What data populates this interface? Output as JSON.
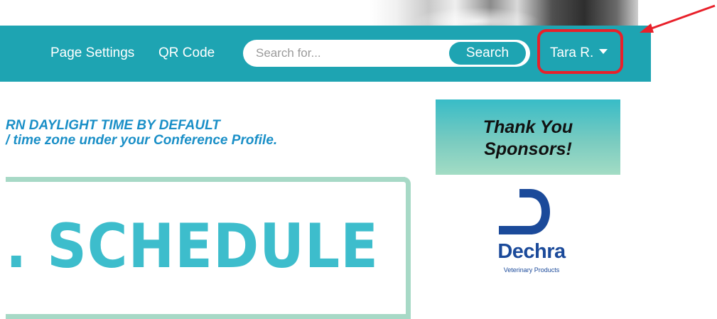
{
  "nav": {
    "page_settings": "Page Settings",
    "qr_code": "QR Code",
    "search": {
      "placeholder": "Search for...",
      "value": "",
      "button_label": "Search"
    },
    "user_name": "Tara R.",
    "user_menu_icon": "caret-down-icon"
  },
  "notice": {
    "line1": "RN DAYLIGHT TIME BY DEFAULT",
    "line2": "/ time zone under your Conference Profile."
  },
  "schedule": {
    "title": ". SCHEDULE"
  },
  "sponsors": {
    "banner_line1": "Thank You",
    "banner_line2": "Sponsors!",
    "logo_name": "Dechra",
    "logo_tagline": "Veterinary Products"
  },
  "annotation": {
    "highlight_color": "#e8202a",
    "target": "user-menu"
  },
  "colors": {
    "nav_bg": "#1ea4b2",
    "schedule_title": "#3dbdcc",
    "schedule_border": "#a7d9c6",
    "notice_text": "#1a8fc7",
    "dechra_blue": "#1b4a9a"
  }
}
